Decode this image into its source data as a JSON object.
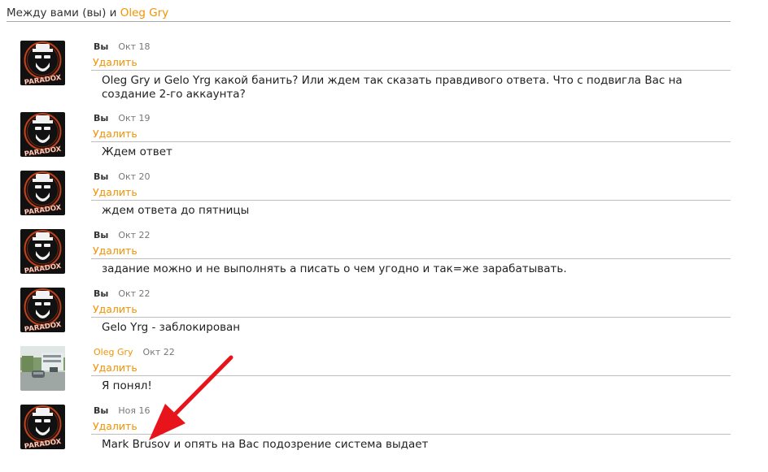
{
  "header": {
    "prefix": "Между вами (вы) и ",
    "partner": "Oleg Gry"
  },
  "delete_label": "Удалить",
  "messages": [
    {
      "author": "Вы",
      "date": "Окт 18",
      "text": "Oleg Gry и Gelo Yrg какой банить? Или ждем так сказать правдивого ответа. Что с подвигла Вас на создание 2-го аккаунта?"
    },
    {
      "author": "Вы",
      "date": "Окт 19",
      "text": "Ждем ответ"
    },
    {
      "author": "Вы",
      "date": "Окт 20",
      "text": "ждем ответа до пятницы"
    },
    {
      "author": "Вы",
      "date": "Окт 22",
      "text": "задание можно и не выполнять а писать о чем угодно и так=же зарабатывать."
    },
    {
      "author": "Вы",
      "date": "Окт 22",
      "text": "Gelo Yrg - заблокирован"
    },
    {
      "author": "Oleg Gry",
      "date": "Окт 22",
      "text": "Я понял!"
    },
    {
      "author": "Вы",
      "date": "Ноя 16",
      "text": "Mark Brusov и опять на Вас подозрение система выдает"
    }
  ],
  "avatar_text": "PARADOX",
  "colors": {
    "accent": "#f39200",
    "arrow": "#e8141b",
    "divider": "#bdbdbd"
  }
}
